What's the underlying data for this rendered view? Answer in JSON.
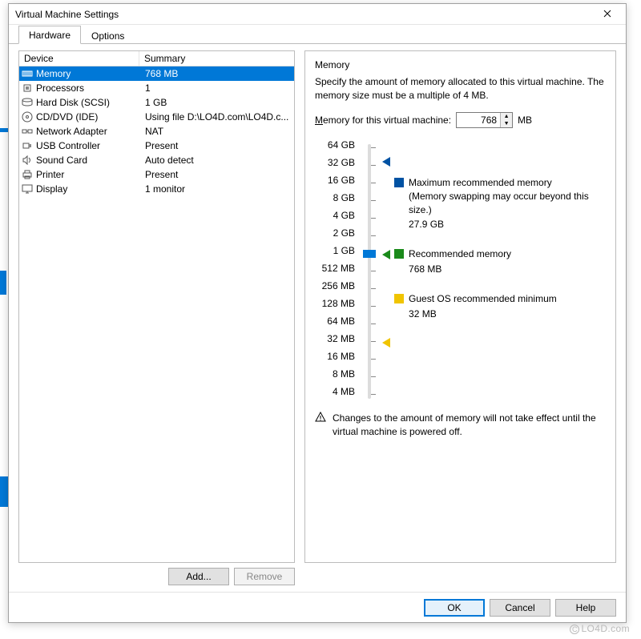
{
  "window": {
    "title": "Virtual Machine Settings"
  },
  "tabs": {
    "hardware": "Hardware",
    "options": "Options"
  },
  "table": {
    "head_device": "Device",
    "head_summary": "Summary",
    "rows": [
      {
        "icon": "memory-icon",
        "device": "Memory",
        "summary": "768 MB"
      },
      {
        "icon": "cpu-icon",
        "device": "Processors",
        "summary": "1"
      },
      {
        "icon": "hdd-icon",
        "device": "Hard Disk (SCSI)",
        "summary": "1 GB"
      },
      {
        "icon": "cd-icon",
        "device": "CD/DVD (IDE)",
        "summary": "Using file D:\\LO4D.com\\LO4D.c..."
      },
      {
        "icon": "net-icon",
        "device": "Network Adapter",
        "summary": "NAT"
      },
      {
        "icon": "usb-icon",
        "device": "USB Controller",
        "summary": "Present"
      },
      {
        "icon": "sound-icon",
        "device": "Sound Card",
        "summary": "Auto detect"
      },
      {
        "icon": "printer-icon",
        "device": "Printer",
        "summary": "Present"
      },
      {
        "icon": "display-icon",
        "device": "Display",
        "summary": "1 monitor"
      }
    ]
  },
  "buttons": {
    "add": "Add...",
    "remove": "Remove",
    "ok": "OK",
    "cancel": "Cancel",
    "help": "Help"
  },
  "memory": {
    "title": "Memory",
    "desc": "Specify the amount of memory allocated to this virtual machine. The memory size must be a multiple of 4 MB.",
    "label_prefix": "M",
    "label_rest": "emory for this virtual machine:",
    "value": "768",
    "unit": "MB",
    "scale": [
      "64 GB",
      "32 GB",
      "16 GB",
      "8 GB",
      "4 GB",
      "2 GB",
      "1 GB",
      "512 MB",
      "256 MB",
      "128 MB",
      "64 MB",
      "32 MB",
      "16 MB",
      "8 MB",
      "4 MB"
    ],
    "legend": {
      "max": {
        "label": "Maximum recommended memory",
        "note": "(Memory swapping may occur beyond this size.)",
        "value": "27.9 GB"
      },
      "rec": {
        "label": "Recommended memory",
        "value": "768 MB"
      },
      "min": {
        "label": "Guest OS recommended minimum",
        "value": "32 MB"
      }
    },
    "warning": "Changes to the amount of memory will not take effect until the virtual machine is powered off."
  },
  "watermark": "LO4D.com"
}
